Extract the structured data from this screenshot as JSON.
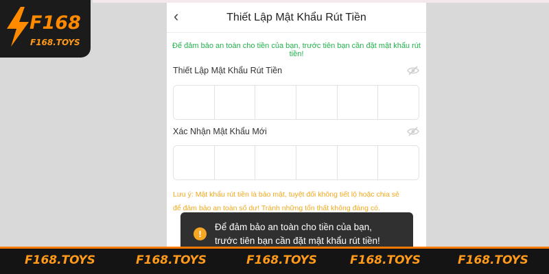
{
  "brand": {
    "logo_text": "F168",
    "logo_subtext": "F168.TOYS",
    "watermark": "F168.TOYS",
    "accent": "#ff8a00"
  },
  "header": {
    "back_icon": "chevron-left-icon",
    "title": "Thiết Lập Mật Khẩu Rút Tiền"
  },
  "notice": "Để đảm bảo an toàn cho tiền của bạn, trước tiên bạn cần đặt mật khẩu rút tiền!",
  "fields": [
    {
      "label": "Thiết Lập Mật Khẩu Rút Tiền",
      "icon": "eye-off-icon",
      "digits": [
        "",
        "",
        "",
        "",
        "",
        ""
      ]
    },
    {
      "label": "Xác Nhận Mật Khẩu Mới",
      "icon": "eye-off-icon",
      "digits": [
        "",
        "",
        "",
        "",
        "",
        ""
      ]
    }
  ],
  "warning": {
    "line1": "Lưu ý: Mật khẩu rút tiền là bảo mật, tuyệt đối không tiết lộ hoặc chia sẻ",
    "line2": "để đảm bảo an toàn số dư! Tránh những tổn thất không đáng có."
  },
  "toast": {
    "icon": "!",
    "line1": "Để đảm bảo an toàn cho tiền của bạn,",
    "line2": "trước tiên bạn cần đặt mật khẩu rút tiền!"
  },
  "colors": {
    "notice_green": "#21b24b",
    "warning_orange": "#f0a81b",
    "toast_bg": "#303030"
  }
}
